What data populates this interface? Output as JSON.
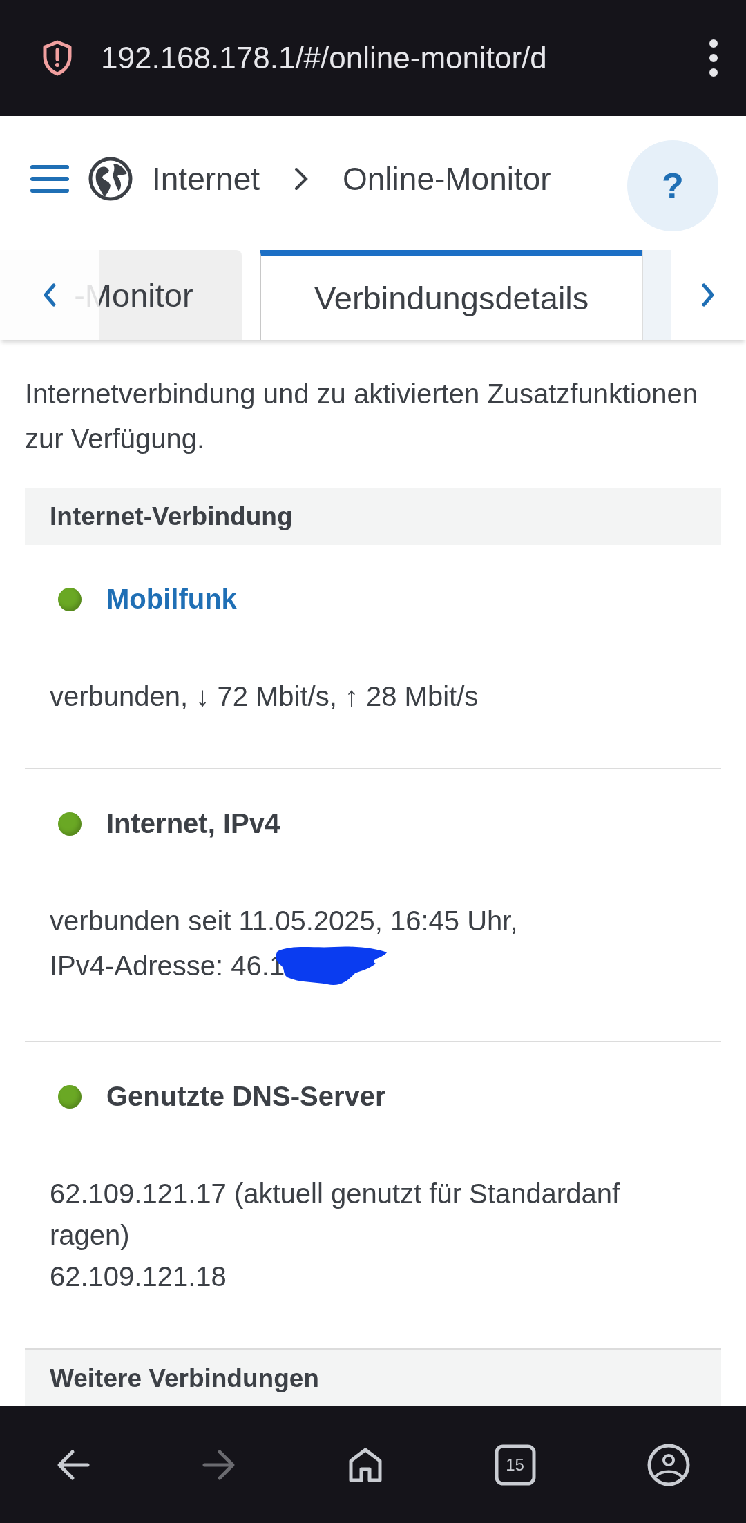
{
  "browser": {
    "url": "192.168.178.1/#/online-monitor/d",
    "tab_count": "15",
    "forward_disabled": true
  },
  "breadcrumb": [
    "Internet",
    "Online-Monitor"
  ],
  "help_label": "?",
  "tabs": [
    {
      "label": "-Monitor",
      "selected": false
    },
    {
      "label": "Verbindungsdetails",
      "selected": true
    }
  ],
  "intro": "Internetverbindung und zu aktivierten Zusatzfunktionen zur Verfügung.",
  "sections": [
    {
      "title": "Internet-Verbindung",
      "items": [
        {
          "title": "Mobilfunk",
          "kind": "link",
          "color": "#6aa824",
          "lines": [
            "verbunden, ↓ 72 Mbit/s, ↑ 28 Mbit/s"
          ]
        },
        {
          "title": "Internet, IPv4",
          "kind": "plain",
          "color": "#6aa824",
          "lines": [
            "verbunden seit 11.05.2025, 16:45 Uhr,",
            "IPv4-Adresse: 46.1"
          ],
          "redacted": true
        },
        {
          "title": "Genutzte DNS-Server",
          "kind": "plain",
          "color": "#6aa824",
          "lines": [
            "62.109.121.17 (aktuell genutzt für Standardanf",
            "ragen)",
            "62.109.121.18"
          ]
        }
      ]
    },
    {
      "title": "Weitere Verbindungen"
    }
  ]
}
